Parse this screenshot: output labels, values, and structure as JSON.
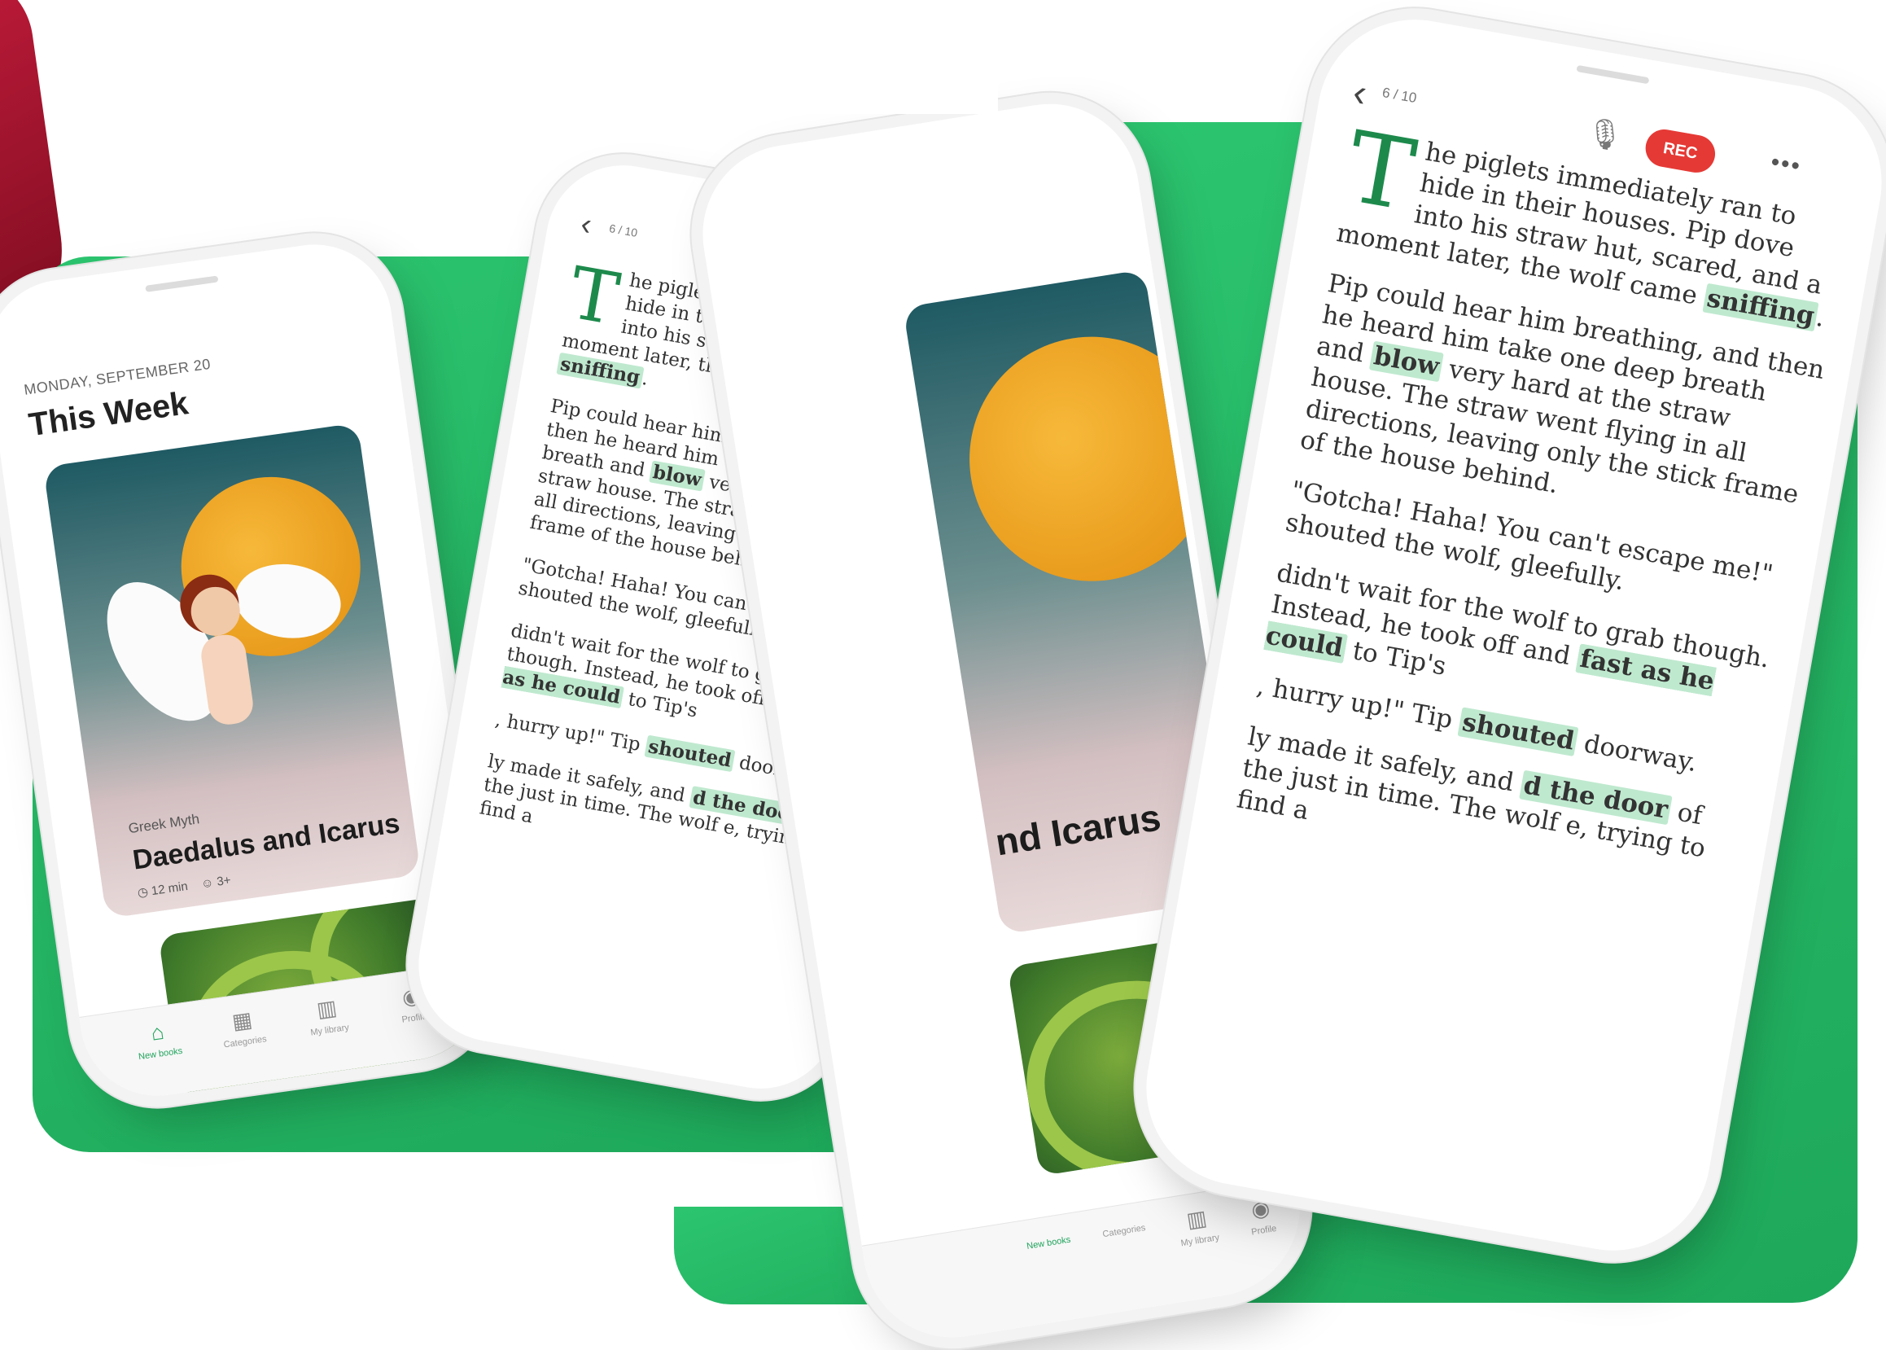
{
  "colors": {
    "accent_green": "#1fa35b",
    "rec_red": "#e53935",
    "highlight": "#bfe9cf",
    "background_green": "#2cc56f"
  },
  "home": {
    "date": "MONDAY, SEPTEMBER 20",
    "section_title": "This Week",
    "featured_book": {
      "genre": "Greek Myth",
      "title": "Daedalus and Icarus",
      "duration": "12 min",
      "age": "3+"
    },
    "tabs": [
      {
        "label": "New books",
        "icon": "home-icon"
      },
      {
        "label": "Categories",
        "icon": "grid-icon"
      },
      {
        "label": "My library",
        "icon": "library-icon"
      },
      {
        "label": "Profile",
        "icon": "profile-icon"
      }
    ],
    "partial_title": "nd Icarus"
  },
  "reader": {
    "page_indicator": "6 / 10",
    "rec_label": "REC",
    "more_label": "•••",
    "p1": {
      "dropcap": "T",
      "a": "he piglets immediately ran to hide in their houses. Pip dove into his straw hut, scared, and a moment later, the wolf came ",
      "h1": "sniffing",
      "b": "."
    },
    "p2": {
      "a": "Pip could hear him breathing, and then he heard him take one deep breath and ",
      "h1": "blow",
      "b": " very hard at the straw house. The straw went flying in all directions, leaving only the stick frame of the house behind."
    },
    "p3": {
      "a": "\"Gotcha! Haha! You can't escape me!\" shouted the wolf, gleefully."
    },
    "p4": {
      "a": "didn't wait for the wolf to grab though. Instead, he took off and ",
      "h1": "fast as he could",
      "b": " to Tip's"
    },
    "p5": {
      "a": ", hurry up!\" Tip ",
      "h1": "shouted",
      "b": " doorway."
    },
    "p6": {
      "a": "ly made it safely, and ",
      "h1": "d the door",
      "b": " of the just in time. The wolf e, trying to find a"
    }
  }
}
